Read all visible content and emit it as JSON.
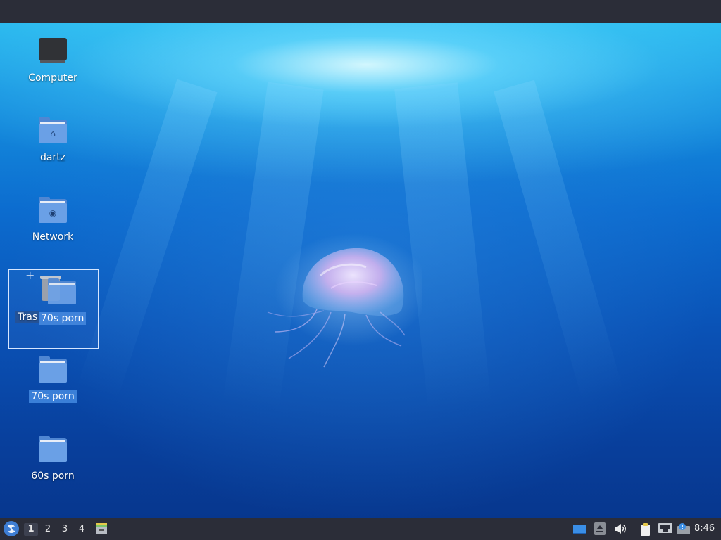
{
  "desktop": {
    "icons": [
      {
        "label": "Computer",
        "icon": "computer-icon"
      },
      {
        "label": "dartz",
        "icon": "home-folder-icon"
      },
      {
        "label": "Network",
        "icon": "network-folder-icon"
      },
      {
        "label": "Tras",
        "icon": "trash-icon"
      },
      {
        "label": "70s porn",
        "icon": "folder-icon"
      },
      {
        "label": "60s porn",
        "icon": "folder-icon"
      }
    ],
    "drag_label": "70s porn"
  },
  "taskbar": {
    "workspaces": [
      "1",
      "2",
      "3",
      "4"
    ],
    "active_workspace": "1",
    "clock": "8:46"
  },
  "colors": {
    "panel": "#2b2d38",
    "folder": "#6aa0e6",
    "selection": "#3a7fd8"
  }
}
